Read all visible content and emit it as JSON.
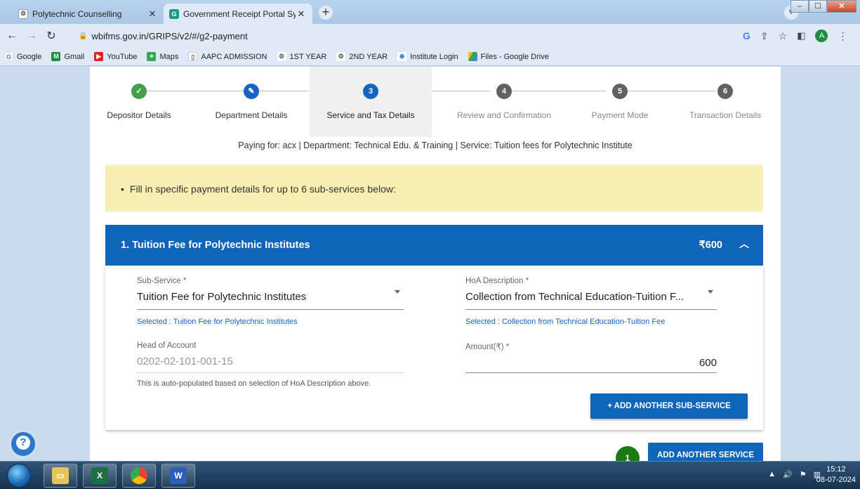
{
  "browser": {
    "tabs": [
      {
        "title": "Polytechnic Counselling",
        "icon": "gear-icon"
      },
      {
        "title": "Government Receipt Portal System",
        "icon": "grips-icon",
        "active": true
      }
    ],
    "url": "wbifms.gov.in/GRIPS/v2/#/g2-payment",
    "profile_initial": "A",
    "google_letter": "G",
    "bookmarks": [
      "Google",
      "Gmail",
      "YouTube",
      "Maps",
      "AAPC ADMISSION",
      "1ST YEAR",
      "2ND YEAR",
      "Institute Login",
      "Files - Google Drive"
    ]
  },
  "stepper": {
    "steps": [
      {
        "label": "Depositor Details",
        "badge": "✓",
        "state": "done"
      },
      {
        "label": "Department Details",
        "badge": "✎",
        "state": "edit"
      },
      {
        "label": "Service and Tax Details",
        "badge": "3",
        "state": "active"
      },
      {
        "label": "Review and Confirmation",
        "badge": "4",
        "state": "pending"
      },
      {
        "label": "Payment Mode",
        "badge": "5",
        "state": "pending"
      },
      {
        "label": "Transaction Details",
        "badge": "6",
        "state": "pending"
      }
    ]
  },
  "paying_for": "Paying for: acx | Department: Technical Edu. & Training | Service: Tuition fees for Polytechnic Institute",
  "notice": "Fill in specific payment details for up to 6 sub-services below:",
  "service": {
    "title": "1. Tuition Fee for Polytechnic Institutes",
    "amount": "₹600",
    "sub_service_label": "Sub-Service *",
    "sub_service_value": "Tuition Fee for Polytechnic Institutes",
    "sub_service_selected": "Selected : Tuition Fee for Polytechnic Institutes",
    "hoa_label": "HoA Description *",
    "hoa_value": "Collection from Technical Education-Tuition F...",
    "hoa_selected": "Selected : Collection from Technical Education-Tuition Fee",
    "head_label": "Head of Account",
    "head_value": "0202-02-101-001-15",
    "head_hint": "This is auto-populated based on selection of HoA Description above.",
    "amount_label": "Amount(₹) *",
    "amount_value": "600",
    "add_sub_service": "+ ADD ANOTHER SUB-SERVICE"
  },
  "service_count": "1",
  "add_service": "ADD ANOTHER SERVICE",
  "taskbar": {
    "time": "15:12",
    "date": "08-07-2024"
  },
  "colors": {
    "primary": "#0f66b8",
    "done": "#43a047",
    "pending": "#616161",
    "notice_bg": "#f7eeb2"
  }
}
